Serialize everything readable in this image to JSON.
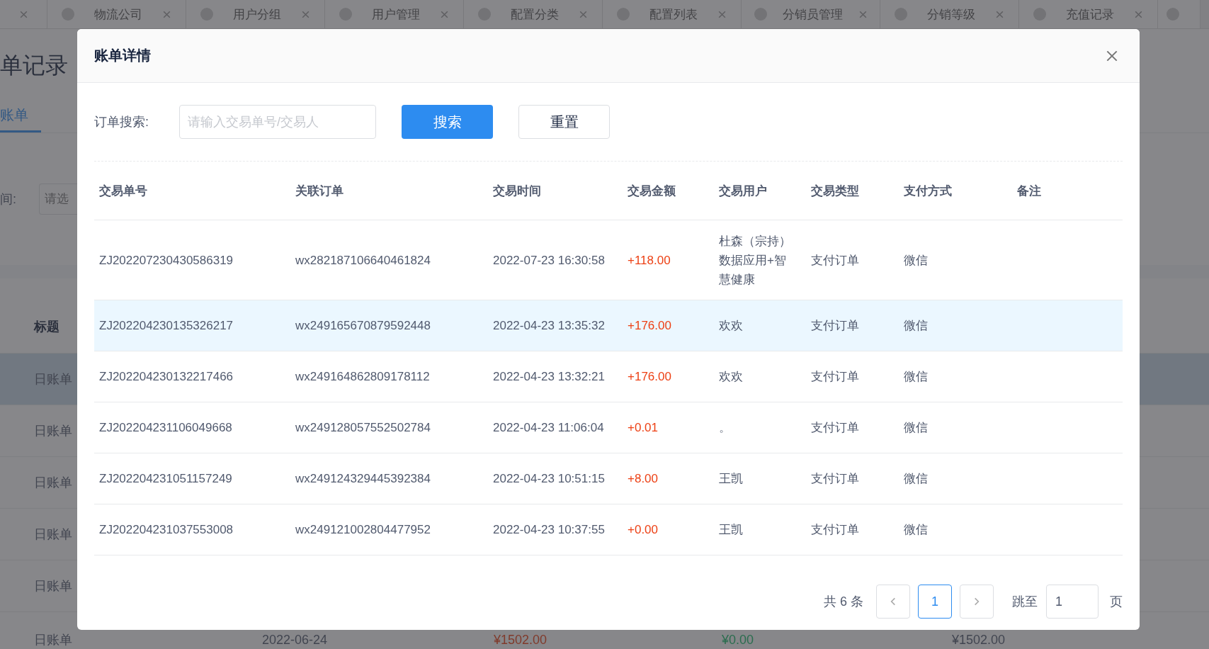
{
  "background": {
    "tab_bar": {
      "tabs": [
        {
          "label": "物流公司"
        },
        {
          "label": "用户分组"
        },
        {
          "label": "用户管理"
        },
        {
          "label": "配置分类"
        },
        {
          "label": "配置列表"
        },
        {
          "label": "分销员管理"
        },
        {
          "label": "分销等级"
        },
        {
          "label": "充值记录"
        }
      ]
    },
    "page_title": "单记录",
    "tabs": [
      {
        "label": "账单",
        "selected": true
      }
    ],
    "filter": {
      "label": "间:",
      "placeholder": "请选"
    },
    "table": {
      "columns": [
        "标题"
      ],
      "rows": [
        {
          "cells": [
            "日账单"
          ],
          "highlighted": true
        },
        {
          "cells": [
            "日账单"
          ],
          "highlighted": false
        },
        {
          "cells": [
            "日账单"
          ],
          "highlighted": false
        },
        {
          "cells": [
            "日账单"
          ],
          "highlighted": false
        },
        {
          "cells": [
            "日账单"
          ],
          "highlighted": false
        },
        {
          "cells": [
            "日账单",
            "2022-06-24",
            "¥1502.00",
            "¥0.00",
            "¥1502.00"
          ],
          "highlighted": false
        }
      ]
    }
  },
  "dialog": {
    "title": "账单详情",
    "search": {
      "label": "订单搜索:",
      "placeholder": "请输入交易单号/交易人",
      "search_button": "搜索",
      "reset_button": "重置"
    },
    "table": {
      "columns": [
        "交易单号",
        "关联订单",
        "交易时间",
        "交易金额",
        "交易用户",
        "交易类型",
        "支付方式",
        "备注"
      ],
      "rows": [
        {
          "cells": [
            "ZJ202207230430586319",
            "wx282187106640461824",
            "2022-07-23 16:30:58",
            "+118.00",
            "杜森（宗持）数据应用+智慧健康",
            "支付订单",
            "微信"
          ],
          "highlighted": false
        },
        {
          "cells": [
            "ZJ202204230135326217",
            "wx249165670879592448",
            "2022-04-23 13:35:32",
            "+176.00",
            "欢欢",
            "支付订单",
            "微信"
          ],
          "highlighted": true
        },
        {
          "cells": [
            "ZJ202204230132217466",
            "wx249164862809178112",
            "2022-04-23 13:32:21",
            "+176.00",
            "欢欢",
            "支付订单",
            "微信"
          ],
          "highlighted": false
        },
        {
          "cells": [
            "ZJ202204231106049668",
            "wx249128057552502784",
            "2022-04-23 11:06:04",
            "+0.01",
            "。",
            "支付订单",
            "微信"
          ],
          "highlighted": false
        },
        {
          "cells": [
            "ZJ202204231051157249",
            "wx249124329445392384",
            "2022-04-23 10:51:15",
            "+8.00",
            "王凯",
            "支付订单",
            "微信"
          ],
          "highlighted": false
        },
        {
          "cells": [
            "ZJ202204231037553008",
            "wx249121002804477952",
            "2022-04-23 10:37:55",
            "+0.00",
            "王凯",
            "支付订单",
            "微信"
          ],
          "highlighted": false
        }
      ]
    },
    "pagination": {
      "total": "共 6 条",
      "pages": [
        {
          "label": "1",
          "selected": true
        }
      ],
      "jump_label": "跳至",
      "jump_value": "1",
      "page_unit": "页"
    }
  }
}
